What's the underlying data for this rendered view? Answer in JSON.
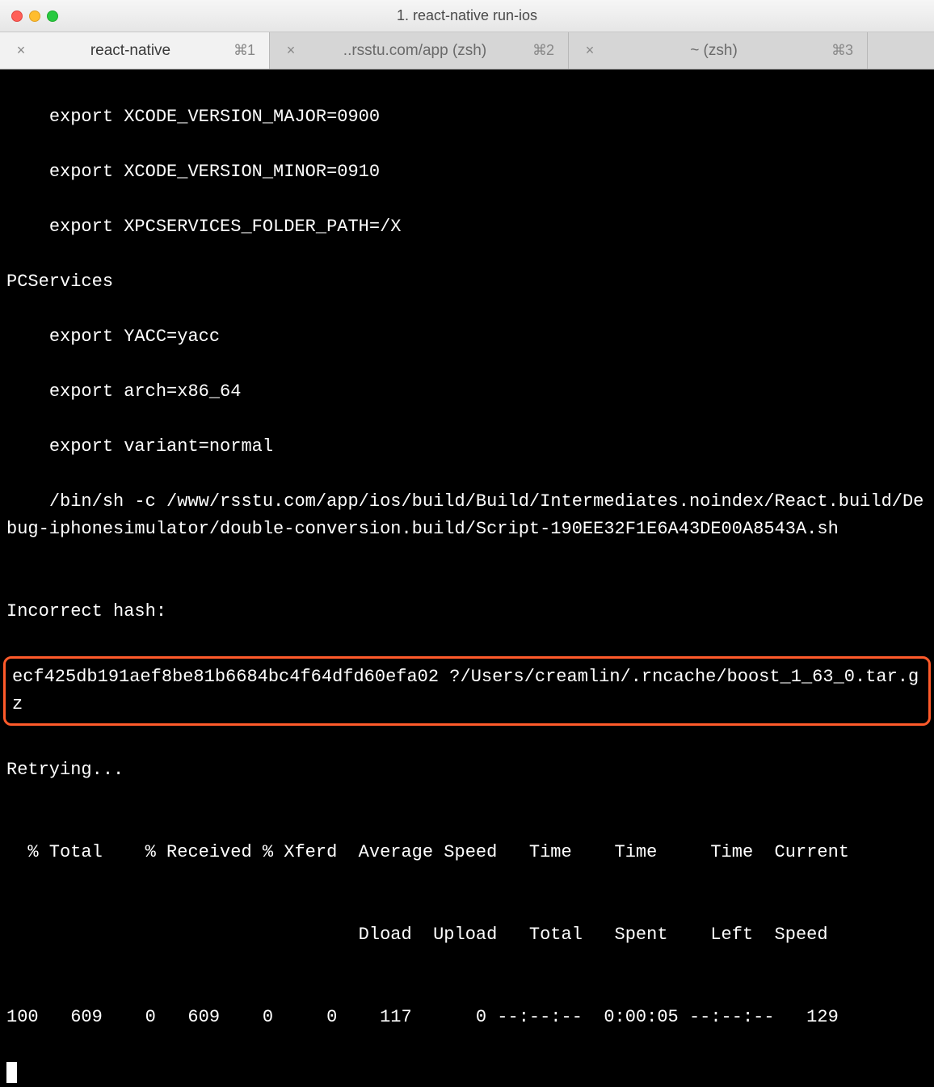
{
  "window": {
    "title": "1. react-native run-ios"
  },
  "tabs": [
    {
      "label": "react-native",
      "shortcut": "⌘1",
      "active": true
    },
    {
      "label": "..rsstu.com/app (zsh)",
      "shortcut": "⌘2",
      "active": false
    },
    {
      "label": "~ (zsh)",
      "shortcut": "⌘3",
      "active": false
    }
  ],
  "terminal": {
    "lines_pre": [
      "    export XCODE_VERSION_MAJOR=0900",
      "    export XCODE_VERSION_MINOR=0910",
      "    export XPCSERVICES_FOLDER_PATH=/X",
      "PCServices",
      "    export YACC=yacc",
      "    export arch=x86_64",
      "    export variant=normal",
      "    /bin/sh -c /www/rsstu.com/app/ios/build/Build/Intermediates.noindex/React.build/Debug-iphonesimulator/double-conversion.build/Script-190EE32F1E6A43DE00A8543A.sh",
      "",
      "Incorrect hash:"
    ],
    "highlight": "ecf425db191aef8be81b6684bc4f64dfd60efa02 ?/Users/creamlin/.rncache/boost_1_63_0.tar.gz",
    "lines_post": [
      "Retrying...",
      "",
      "  % Total    % Received % Xferd  Average Speed   Time    Time     Time  Current",
      "",
      "                                 Dload  Upload   Total   Spent    Left  Speed",
      "",
      "100   609    0   609    0     0    117      0 --:--:--  0:00:05 --:--:--   129"
    ]
  }
}
